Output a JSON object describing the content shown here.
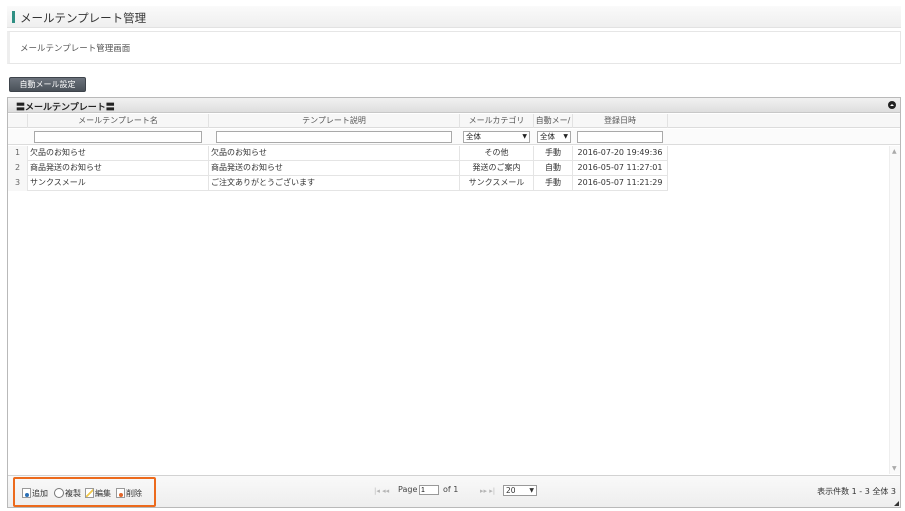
{
  "page": {
    "title": "メールテンプレート管理",
    "description": "メールテンプレート管理画面"
  },
  "auto_mail_button": "自動メール設定",
  "grid": {
    "caption": "〓メールテンプレート〓",
    "columns": [
      "メールテンプレート名",
      "テンプレート説明",
      "メールカテゴリ",
      "自動メー/",
      "登録日時"
    ],
    "filters": {
      "category_selected": "全体",
      "auto_selected": "全体"
    },
    "rows": [
      {
        "n": "1",
        "name": "欠品のお知らせ",
        "desc": "欠品のお知らせ",
        "category": "その他",
        "auto": "手動",
        "date": "2016-07-20 19:49:36"
      },
      {
        "n": "2",
        "name": "商品発送のお知らせ",
        "desc": "商品発送のお知らせ",
        "category": "発送のご案内",
        "auto": "自動",
        "date": "2016-05-07 11:27:01"
      },
      {
        "n": "3",
        "name": "サンクスメール",
        "desc": "ご注文ありがとうございます",
        "category": "サンクスメール",
        "auto": "手動",
        "date": "2016-05-07 11:21:29"
      }
    ]
  },
  "toolbar": {
    "add": "追加",
    "copy": "複製",
    "edit": "編集",
    "delete": "削除"
  },
  "pager": {
    "page_label": "Page",
    "page_value": "1",
    "of_label": "of 1",
    "rows_per_page": "20",
    "info": "表示件数 1 - 3 全体 3"
  },
  "colors": {
    "title_accent": "#2f8f83",
    "toolbar_highlight": "#ec6a1c"
  }
}
